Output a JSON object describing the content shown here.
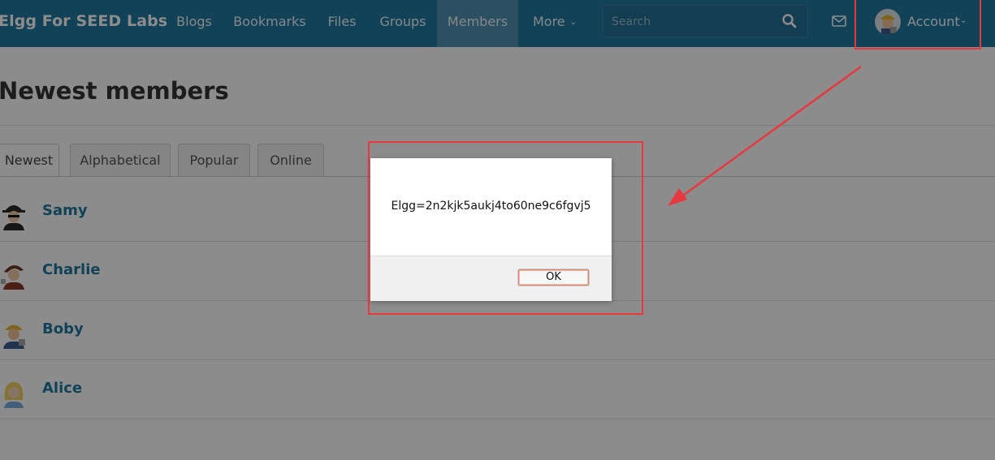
{
  "header": {
    "site_name": "Elgg For SEED Labs",
    "nav": [
      {
        "label": "Blogs"
      },
      {
        "label": "Bookmarks"
      },
      {
        "label": "Files"
      },
      {
        "label": "Groups"
      },
      {
        "label": "Members",
        "active": true
      },
      {
        "label": "More",
        "has_dropdown": true
      }
    ],
    "search_placeholder": "Search",
    "account_label": "Account",
    "icons": {
      "search": "search-icon",
      "messages": "envelope-icon",
      "dropdown": "chevron-down-icon"
    }
  },
  "main": {
    "title": "Newest members",
    "tabs": [
      {
        "label": "Newest",
        "selected": true
      },
      {
        "label": "Alphabetical"
      },
      {
        "label": "Popular"
      },
      {
        "label": "Online"
      }
    ],
    "members": [
      {
        "name": "Samy"
      },
      {
        "name": "Charlie"
      },
      {
        "name": "Boby"
      },
      {
        "name": "Alice"
      }
    ]
  },
  "alert": {
    "message": "Elgg=2n2kjk5aukj4to60ne9c6fgvj5",
    "ok_label": "OK"
  },
  "colors": {
    "header_bg": "#1f79a0",
    "active_nav_bg": "#4f93b3",
    "link": "#1f79a0",
    "annotation": "#e8383f"
  }
}
